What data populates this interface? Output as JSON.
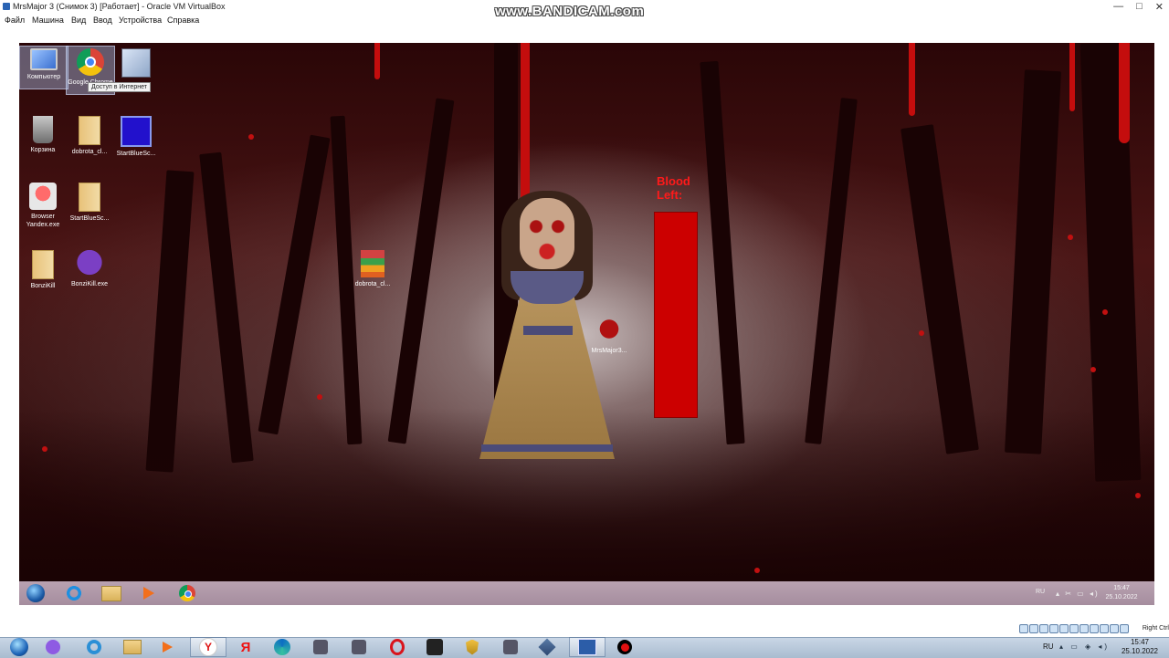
{
  "host_window": {
    "title": "MrsMajor 3 (Снимок 3) [Работает] - Oracle VM VirtualBox",
    "controls": {
      "minimize": "—",
      "maximize": "□",
      "close": "✕"
    },
    "menu": [
      "Файл",
      "Машина",
      "Вид",
      "Ввод",
      "Устройства",
      "Справка"
    ]
  },
  "watermark": "www.BANDICAM.com",
  "desktop": {
    "icons": [
      {
        "label": "Компьютер",
        "icon": "computer-icon"
      },
      {
        "label": "Google Chrome",
        "icon": "chrome-icon"
      },
      {
        "label": "",
        "icon": "virtualbox-icon"
      },
      {
        "label": "Корзина",
        "icon": "recycle-bin-icon"
      },
      {
        "label": "dobrota_cl...",
        "icon": "folder-icon"
      },
      {
        "label": "StartBlueSc...",
        "icon": "window-app-icon"
      },
      {
        "label": "Browser Yandex.exe",
        "icon": "yandex-browser-icon"
      },
      {
        "label": "StartBlueSc...",
        "icon": "folder-icon"
      },
      {
        "label": "BonziKill",
        "icon": "folder-icon"
      },
      {
        "label": "BonziKill.exe",
        "icon": "bonzi-icon"
      },
      {
        "label": "dobrota_cl...",
        "icon": "archive-icon"
      },
      {
        "label": "MrsMajor3...",
        "icon": "doll-app-icon"
      }
    ],
    "tooltip": "Доступ в Интернет",
    "blood_meter": {
      "label_line1": "Blood",
      "label_line2": "Left:",
      "level": 1.0,
      "color": "#cc0000"
    }
  },
  "guest_taskbar": {
    "pinned": [
      "start-orb-icon",
      "internet-explorer-icon",
      "explorer-folder-icon",
      "media-player-icon",
      "chrome-icon"
    ],
    "lang": "RU",
    "time": "15:47",
    "date": "25.10.2022"
  },
  "host_taskbar": {
    "apps": [
      "start-orb-icon",
      "purple-app-icon",
      "edge-legacy-icon",
      "explorer-folder-icon",
      "media-player-icon",
      "yandex-browser-icon",
      "yandex-icon",
      "edge-icon",
      "gear-app-icon",
      "world-of-warships-icon",
      "opera-icon",
      "game-icon",
      "world-of-tanks-icon",
      "warships-icon",
      "virtualbox-icon",
      "vm-window-icon",
      "bandicam-record-icon"
    ],
    "lang": "RU",
    "time": "15:47",
    "date": "25.10.2022"
  },
  "vbox_status": {
    "host_key": "Right Ctrl"
  }
}
